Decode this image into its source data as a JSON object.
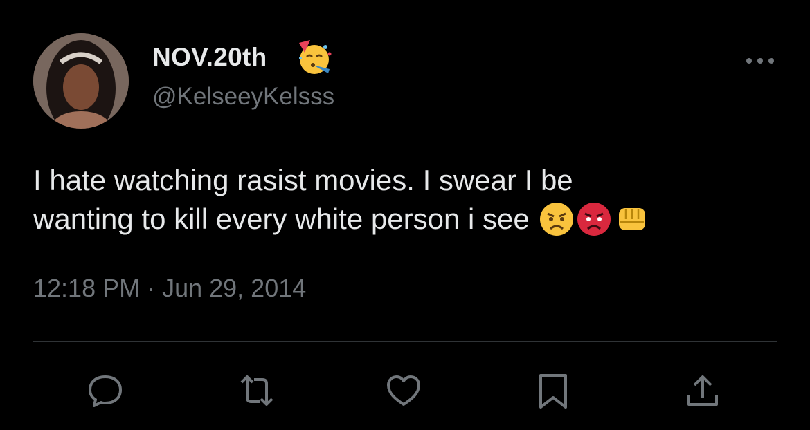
{
  "author": {
    "display_name": "NOV.20th",
    "handle": "@KelseeyKelsss",
    "badge_icon": "partying-face-emoji-icon"
  },
  "tweet": {
    "text_line1": "I hate watching rasist movies. I swear I be",
    "text_line2": "wanting to kill every white person i see",
    "emojis": [
      "angry-face-emoji-icon",
      "pouting-face-emoji-icon",
      "oncoming-fist-emoji-icon"
    ],
    "timestamp": "12:18 PM · Jun 29, 2014"
  },
  "actions": [
    "reply-icon",
    "retweet-icon",
    "like-icon",
    "bookmark-icon",
    "share-icon"
  ],
  "colors": {
    "background": "#000000",
    "text": "#e7e9ea",
    "secondary": "#71767b",
    "divider": "#2f3336"
  }
}
